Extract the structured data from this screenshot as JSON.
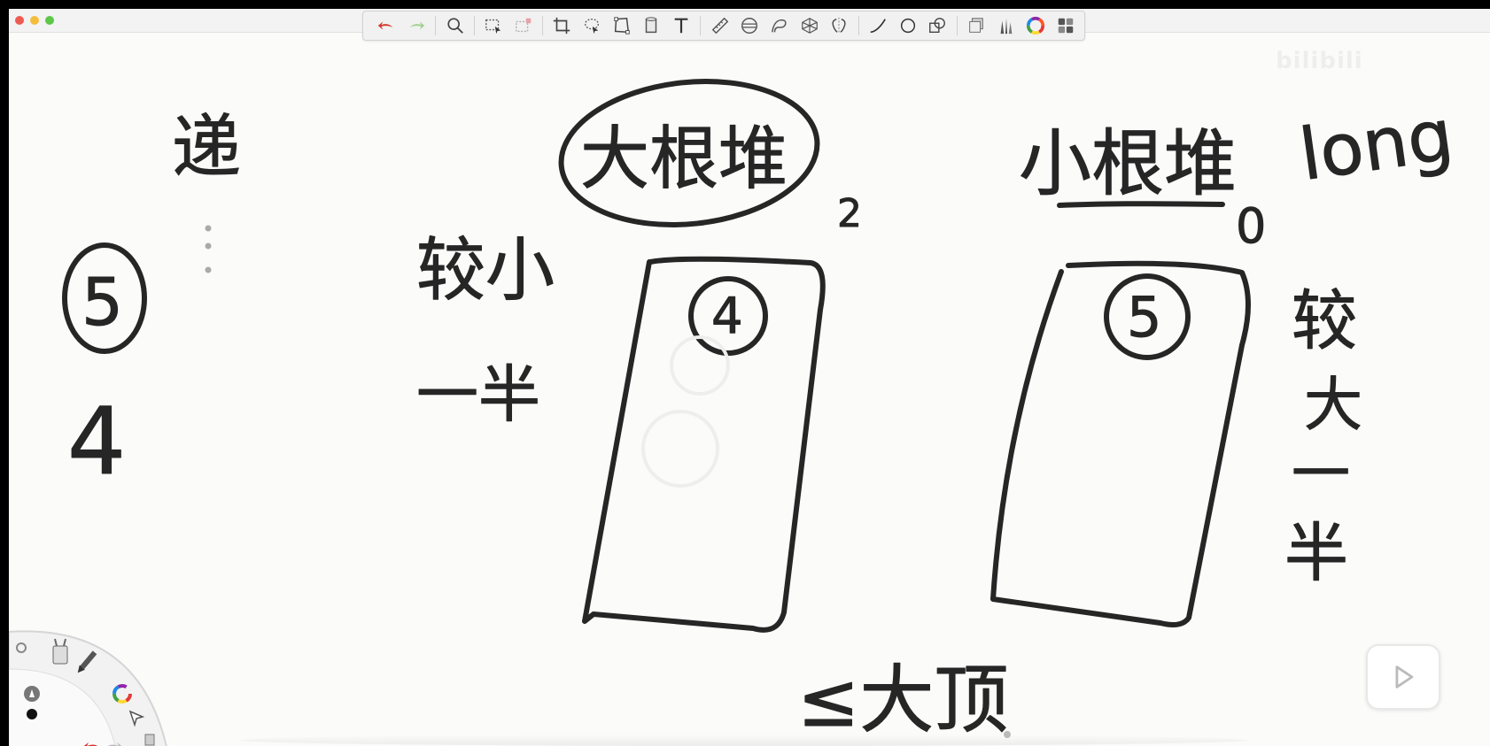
{
  "window": {
    "traffic_lights": [
      {
        "name": "close",
        "color": "#ee5b52"
      },
      {
        "name": "minimize",
        "color": "#f5bd3d"
      },
      {
        "name": "zoom",
        "color": "#5dc74a"
      }
    ]
  },
  "toolbar": {
    "tools": [
      {
        "id": "undo",
        "icon": "undo-arrow-icon",
        "color": "#d6352a"
      },
      {
        "id": "redo",
        "icon": "redo-arrow-icon",
        "color": "#9ed08c"
      },
      {
        "id": "zoom",
        "icon": "magnifier-icon"
      },
      {
        "id": "select",
        "icon": "rect-select-icon"
      },
      {
        "id": "select-alt",
        "icon": "rect-select-alt-icon"
      },
      {
        "id": "crop",
        "icon": "crop-icon"
      },
      {
        "id": "lasso",
        "icon": "lasso-icon"
      },
      {
        "id": "transform",
        "icon": "transform-icon"
      },
      {
        "id": "layer",
        "icon": "layer-icon"
      },
      {
        "id": "text",
        "icon": "text-icon",
        "text": "T"
      },
      {
        "id": "ruler",
        "icon": "ruler-icon"
      },
      {
        "id": "ellipse-guide",
        "icon": "ellipse-guide-icon"
      },
      {
        "id": "french-curve",
        "icon": "french-curve-icon"
      },
      {
        "id": "perspective",
        "icon": "perspective-grid-icon"
      },
      {
        "id": "symmetry",
        "icon": "symmetry-icon"
      },
      {
        "id": "line",
        "icon": "line-icon"
      },
      {
        "id": "circle",
        "icon": "circle-icon"
      },
      {
        "id": "shapes",
        "icon": "shapes-icon"
      },
      {
        "id": "layers",
        "icon": "layers-icon"
      },
      {
        "id": "brushes",
        "icon": "brushes-icon"
      },
      {
        "id": "color",
        "icon": "color-wheel-icon"
      },
      {
        "id": "apps",
        "icon": "grid-apps-icon"
      }
    ]
  },
  "canvas": {
    "ink_color": "#262626",
    "handwriting": {
      "top_left": "递",
      "circled_left": "5",
      "below_left": "4",
      "left_of_heap1_line1": "较小",
      "left_of_heap1_line2": "一半",
      "heap1_title": "大根堆",
      "heap1_sub": "2",
      "heap1_root": "4",
      "heap2_title": "小根堆",
      "heap2_sub": "0",
      "heap2_root": "5",
      "right_note": "long",
      "right_side_1": "较",
      "right_side_2": "大",
      "right_side_3": "一",
      "right_side_4": "半",
      "bottom": "≤大顶"
    }
  },
  "watermark": {
    "text": "bilibili"
  },
  "player": {
    "play_icon": "play-triangle-icon"
  },
  "radial_menu": {
    "items": [
      {
        "icon": "brush-cup-icon"
      },
      {
        "icon": "brush-icon"
      },
      {
        "icon": "color-wheel-icon"
      },
      {
        "icon": "pen-nib-icon"
      },
      {
        "icon": "color-swatch-icon",
        "color": "#111111"
      },
      {
        "icon": "cursor-icon"
      },
      {
        "icon": "undo-arrow-icon",
        "color": "#d6352a"
      },
      {
        "icon": "redo-arrow-icon"
      },
      {
        "icon": "layers-icon"
      }
    ]
  }
}
